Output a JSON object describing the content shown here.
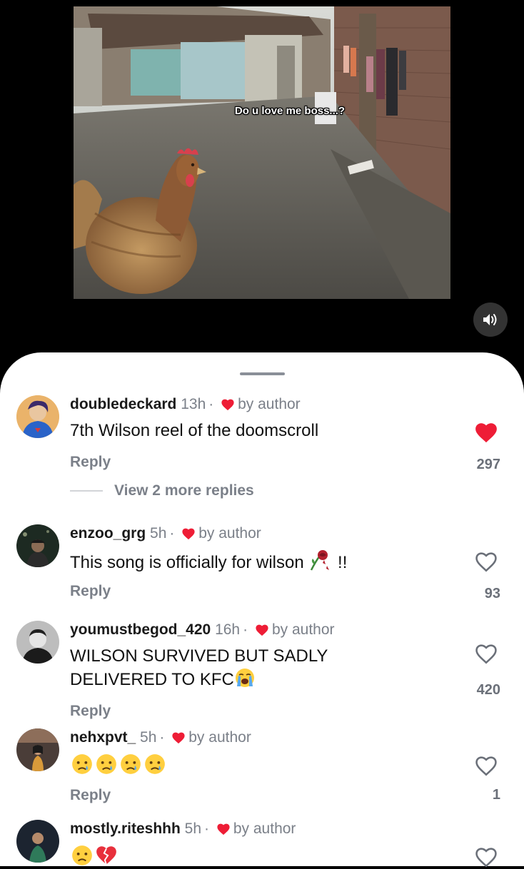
{
  "video": {
    "caption": "Do u love me boss...?",
    "sound_icon": "speaker-volume-icon"
  },
  "comments": [
    {
      "username": "doubledeckard",
      "time": "13h",
      "by_author": "by author",
      "text": "7th Wilson reel of the doomscroll",
      "reply_label": "Reply",
      "likes": "297",
      "liked": true,
      "more_replies": "View 2 more replies"
    },
    {
      "username": "enzoo_grg",
      "time": "5h",
      "by_author": "by author",
      "text": "This song is officially for wilson",
      "text_suffix": "!!",
      "emojis": [
        "wilted-rose-emoji"
      ],
      "reply_label": "Reply",
      "likes": "93",
      "liked": false
    },
    {
      "username": "youmustbegod_420",
      "time": "16h",
      "by_author": "by author",
      "text_line1": "WILSON SURVIVED BUT SADLY",
      "text_line2": "DELIVERED TO KFC",
      "emojis": [
        "loudly-crying-emoji"
      ],
      "reply_label": "Reply",
      "likes": "420",
      "liked": false
    },
    {
      "username": "nehxpvt_",
      "time": "5h",
      "by_author": "by author",
      "emojis": [
        "crying-face-emoji",
        "crying-face-emoji",
        "crying-face-emoji",
        "crying-face-emoji"
      ],
      "reply_label": "Reply",
      "likes": "1",
      "liked": false
    },
    {
      "username": "mostly.riteshhh",
      "time": "5h",
      "by_author": "by author",
      "emojis": [
        "crying-face-emoji",
        "broken-heart-emoji"
      ],
      "liked": false
    }
  ],
  "colors": {
    "heart_red": "#ee1d36",
    "muted_text": "#7b8089",
    "sheet_bg": "#ffffff"
  }
}
